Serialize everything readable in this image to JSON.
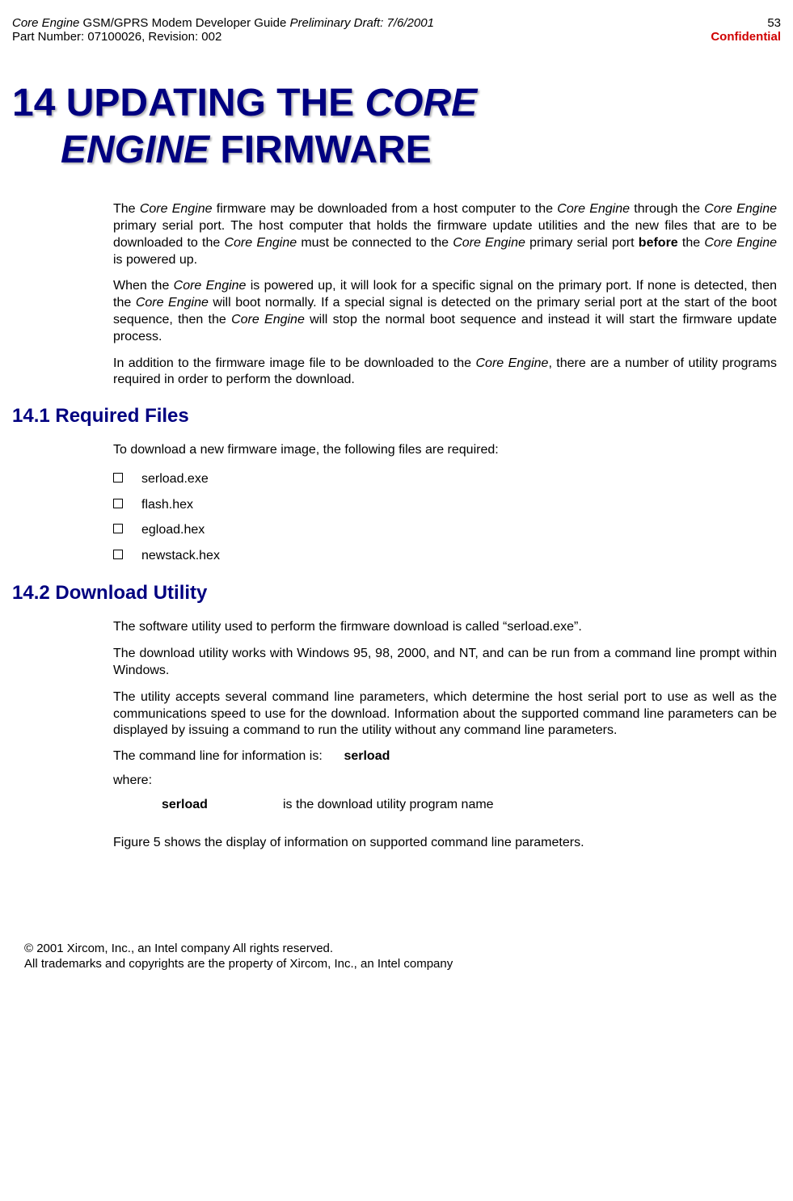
{
  "header": {
    "product_italic": "Core Engine",
    "product_rest": " GSM/GPRS Modem Developer Guide ",
    "draft_italic": "Preliminary Draft: 7/6/2001",
    "part_number": "Part Number: 07100026, Revision: 002",
    "page_number": "53",
    "confidential": "Confidential"
  },
  "main_title": {
    "part1": "14 UPDATING THE ",
    "part2_italic": "CORE",
    "part3_indent_italic": "ENGINE",
    "part4": " FIRMWARE"
  },
  "intro": {
    "p1_parts": {
      "t1": "The ",
      "i1": "Core Engine",
      "t2": " firmware may be downloaded from a host computer to the ",
      "i2": "Core Engine",
      "t3": " through the ",
      "i3": "Core Engine",
      "t4": " primary serial port.  The host computer that holds the firmware update utilities and the new files that are to be downloaded to the ",
      "i4": "Core Engine",
      "t5": " must be connected to the ",
      "i5": "Core Engine",
      "t6": " primary serial port ",
      "b1": "before",
      "t7": " the ",
      "i6": "Core Engine",
      "t8": " is powered up."
    },
    "p2_parts": {
      "t1": "When the ",
      "i1": "Core Engine",
      "t2": " is powered up, it will look for a specific signal on the primary port. If none is detected, then the ",
      "i2": "Core Engine",
      "t3": " will boot normally.  If a special signal is detected on the primary serial port at the start of the boot sequence, then the ",
      "i3": "Core Engine",
      "t4": " will stop the normal boot sequence and instead it will start the firmware update process."
    },
    "p3_parts": {
      "t1": "In addition to the firmware image file to be downloaded to the ",
      "i1": "Core Engine",
      "t2": ", there are a number of utility programs required in order to perform the download."
    }
  },
  "section1": {
    "heading": "14.1 Required Files",
    "intro": "To download a new firmware image, the following files are required:",
    "files": {
      "f0": "serload.exe",
      "f1": "flash.hex",
      "f2": "egload.hex",
      "f3": "newstack.hex"
    }
  },
  "section2": {
    "heading": "14.2 Download Utility",
    "p1": "The software utility used to perform the firmware download is called “serload.exe”.",
    "p2": "The download utility works with Windows 95, 98, 2000, and NT, and can be run from a command line prompt within Windows.",
    "p3": "The utility accepts several command line parameters, which determine the host serial port to use as well as the communications speed to use for the download.  Information about the supported command line parameters can be displayed by issuing a command to run the utility without any command line parameters.",
    "cmd_label": "The command line for information is:",
    "cmd_value": "serload",
    "where": "where:",
    "serload_label": "serload",
    "serload_desc": "is the download utility program name",
    "p4": "Figure 5 shows the display of information on supported command line parameters."
  },
  "footer": {
    "line1": "© 2001 Xircom, Inc., an Intel company All rights reserved.",
    "line2": "All trademarks and copyrights are the property of Xircom, Inc., an Intel company"
  }
}
